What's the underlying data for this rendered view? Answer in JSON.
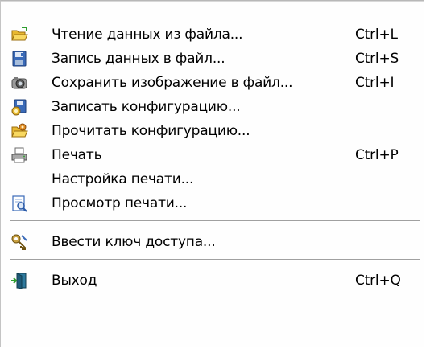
{
  "menu": {
    "items": [
      {
        "label": "Чтение данных из файла...",
        "shortcut": "Ctrl+L",
        "icon": "open-folder-icon"
      },
      {
        "label": "Запись данных в файл...",
        "shortcut": "Ctrl+S",
        "icon": "floppy-disk-icon"
      },
      {
        "label": "Сохранить изображение в файл...",
        "shortcut": "Ctrl+I",
        "icon": "camera-icon"
      },
      {
        "label": "Записать конфигурацию...",
        "shortcut": "",
        "icon": "save-config-icon"
      },
      {
        "label": "Прочитать конфигурацию...",
        "shortcut": "",
        "icon": "load-config-icon"
      },
      {
        "label": "Печать",
        "shortcut": "Ctrl+P",
        "icon": "printer-icon"
      },
      {
        "label": "Настройка печати...",
        "shortcut": "",
        "icon": ""
      },
      {
        "label": "Просмотр печати...",
        "shortcut": "",
        "icon": "print-preview-icon"
      },
      {
        "label": "Ввести ключ доступа...",
        "shortcut": "",
        "icon": "access-key-icon"
      },
      {
        "label": "Выход",
        "shortcut": "Ctrl+Q",
        "icon": "exit-door-icon"
      }
    ]
  }
}
